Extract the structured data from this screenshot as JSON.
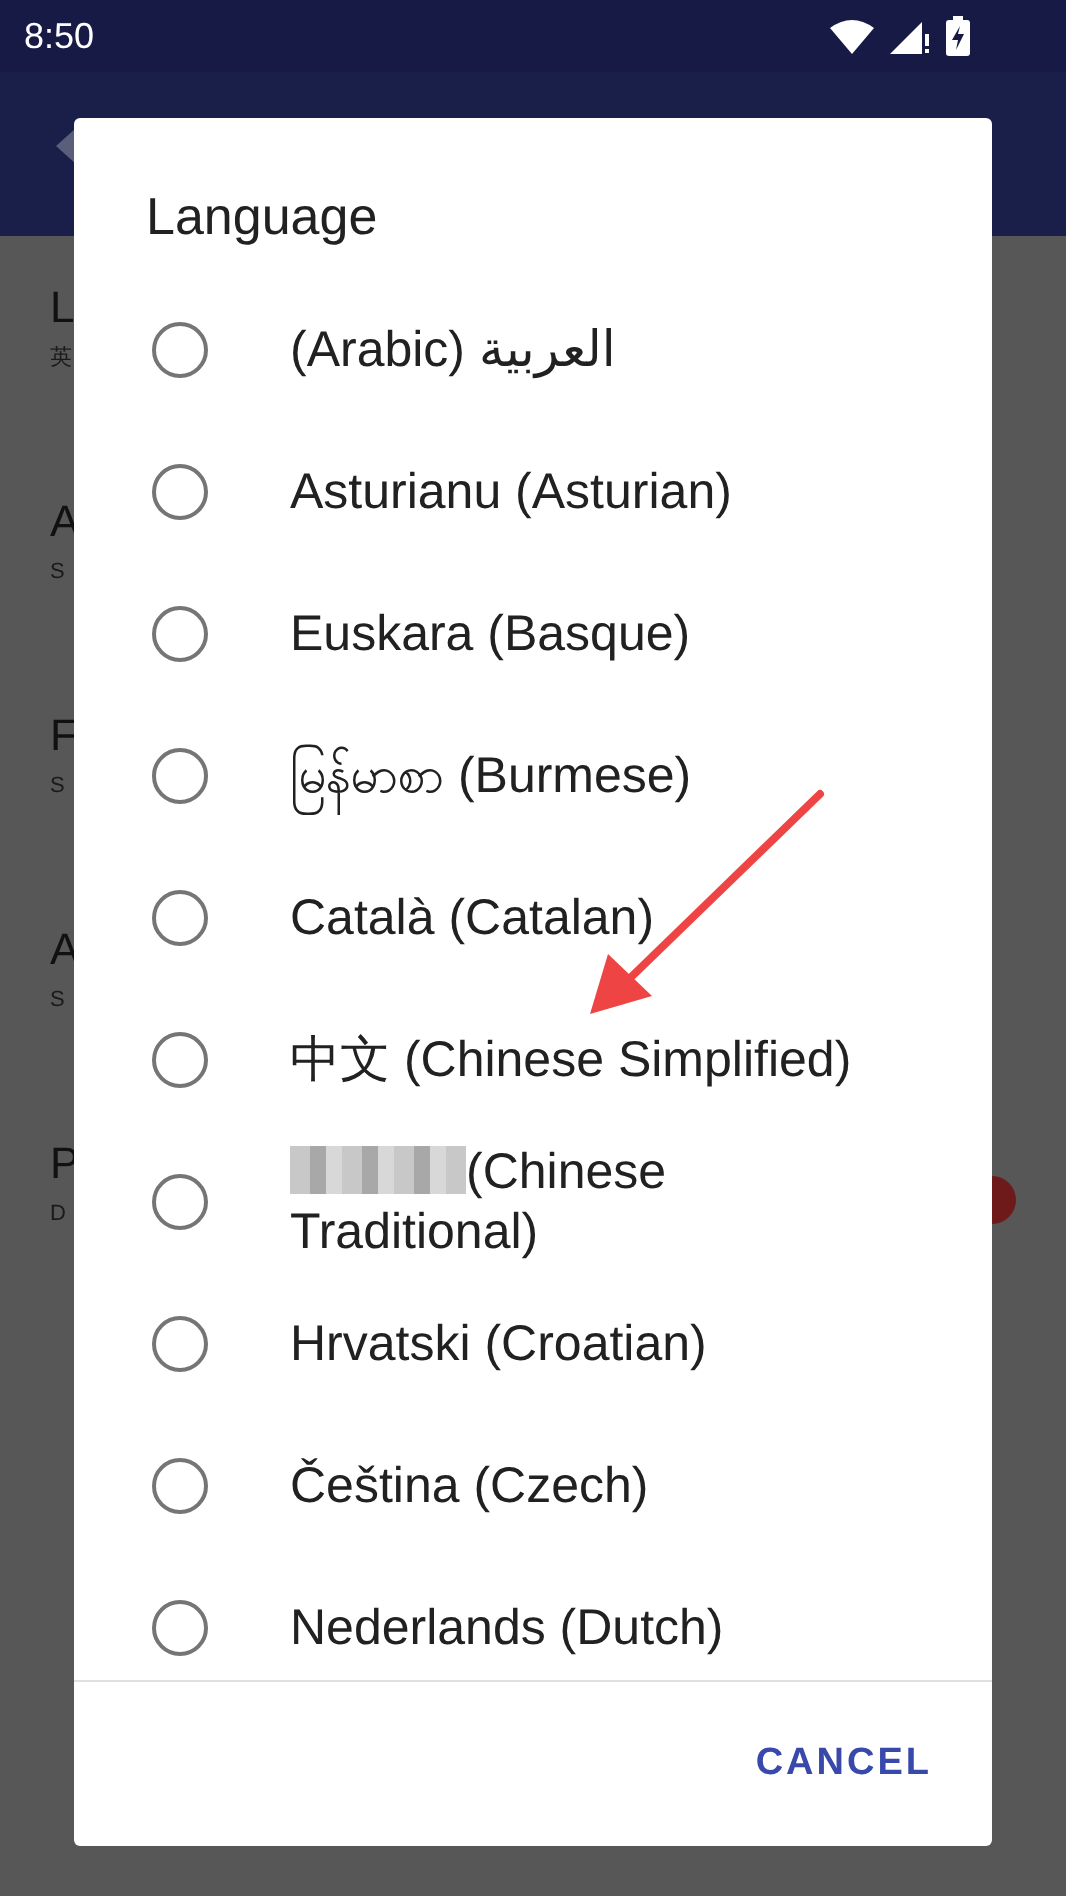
{
  "status_bar": {
    "time": "8:50"
  },
  "background_list": [
    {
      "title": "L",
      "subtitle": "英"
    },
    {
      "title": "A",
      "subtitle": "S"
    },
    {
      "title": "F",
      "subtitle": "S"
    },
    {
      "title": "A",
      "subtitle": "S"
    },
    {
      "title": "P",
      "subtitle": "D"
    }
  ],
  "dialog": {
    "title": "Language",
    "options": [
      {
        "label": "(Arabic) العربية",
        "selected": false
      },
      {
        "label": "Asturianu (Asturian)",
        "selected": false
      },
      {
        "label": "Euskara (Basque)",
        "selected": false
      },
      {
        "label": "မြန်မာစာ (Burmese)",
        "selected": false
      },
      {
        "label": "Català (Catalan)",
        "selected": false
      },
      {
        "label": "中文 (Chinese Simplified)",
        "selected": false
      },
      {
        "label": "(Chinese Traditional)",
        "selected": false,
        "kind": "blurred"
      },
      {
        "label": "Hrvatski (Croatian)",
        "selected": false
      },
      {
        "label": "Čeština (Czech)",
        "selected": false
      },
      {
        "label": "Nederlands (Dutch)",
        "selected": false
      }
    ],
    "buttons": [
      "CANCEL"
    ]
  }
}
